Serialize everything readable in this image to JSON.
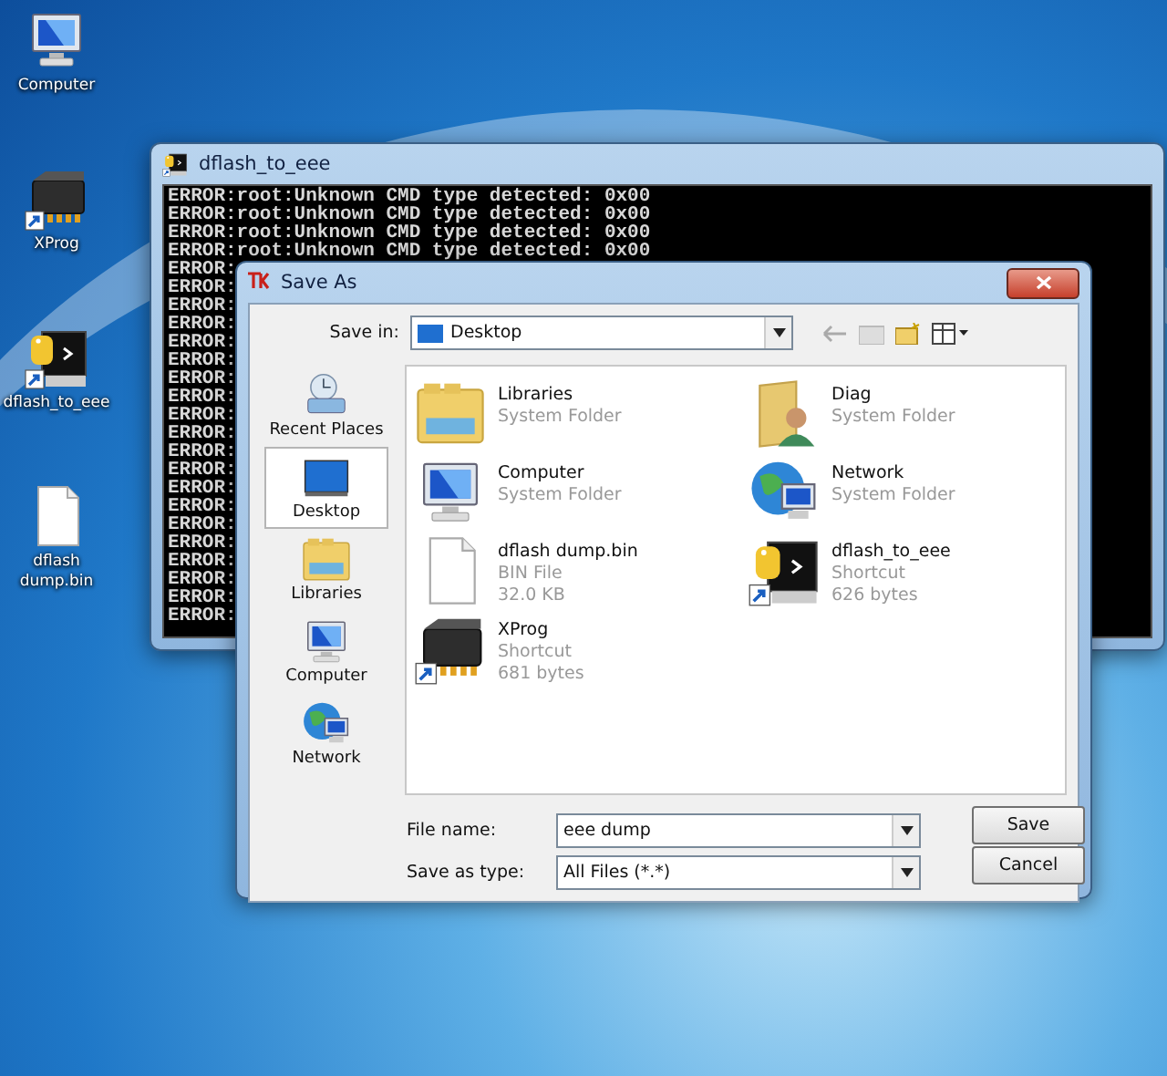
{
  "desktop_icons": [
    {
      "label": "Computer",
      "kind": "computer"
    },
    {
      "label": "XProg",
      "kind": "chip"
    },
    {
      "label": "dflash_to_eee",
      "kind": "python"
    },
    {
      "label": "dflash dump.bin",
      "kind": "file"
    }
  ],
  "console": {
    "title": "dflash_to_eee",
    "lines": [
      "ERROR:root:Unknown CMD type detected: 0x00",
      "ERROR:root:Unknown CMD type detected: 0x00",
      "ERROR:root:Unknown CMD type detected: 0x00",
      "ERROR:root:Unknown CMD type detected: 0x00",
      "ERROR:",
      "ERROR:",
      "ERROR:",
      "ERROR:",
      "ERROR:",
      "ERROR:",
      "ERROR:",
      "ERROR:",
      "ERROR:",
      "ERROR:",
      "ERROR:",
      "ERROR:",
      "ERROR:",
      "ERROR:",
      "ERROR:",
      "ERROR:",
      "ERROR:",
      "ERROR:",
      "ERROR:",
      "ERROR:"
    ]
  },
  "dialog": {
    "title": "Save As",
    "save_in": {
      "label": "Save in:",
      "value": "Desktop"
    },
    "places": [
      {
        "label": "Recent Places",
        "kind": "recent",
        "selected": false
      },
      {
        "label": "Desktop",
        "kind": "desktop",
        "selected": true
      },
      {
        "label": "Libraries",
        "kind": "libraries",
        "selected": false
      },
      {
        "label": "Computer",
        "kind": "computer",
        "selected": false
      },
      {
        "label": "Network",
        "kind": "network",
        "selected": false
      }
    ],
    "files": [
      {
        "name": "Libraries",
        "details": [
          "System Folder"
        ],
        "kind": "libraries"
      },
      {
        "name": "Diag",
        "details": [
          "System Folder"
        ],
        "kind": "user"
      },
      {
        "name": "Computer",
        "details": [
          "System Folder"
        ],
        "kind": "computer"
      },
      {
        "name": "Network",
        "details": [
          "System Folder"
        ],
        "kind": "network"
      },
      {
        "name": "dflash dump.bin",
        "details": [
          "BIN File",
          "32.0 KB"
        ],
        "kind": "file"
      },
      {
        "name": "dflash_to_eee",
        "details": [
          "Shortcut",
          "626 bytes"
        ],
        "kind": "python"
      },
      {
        "name": "XProg",
        "details": [
          "Shortcut",
          "681 bytes"
        ],
        "kind": "chip"
      }
    ],
    "file_name": {
      "label": "File name:",
      "value": "eee dump"
    },
    "save_type": {
      "label": "Save as type:",
      "value": "All Files (*.*)"
    },
    "buttons": [
      "Save",
      "Cancel"
    ]
  }
}
